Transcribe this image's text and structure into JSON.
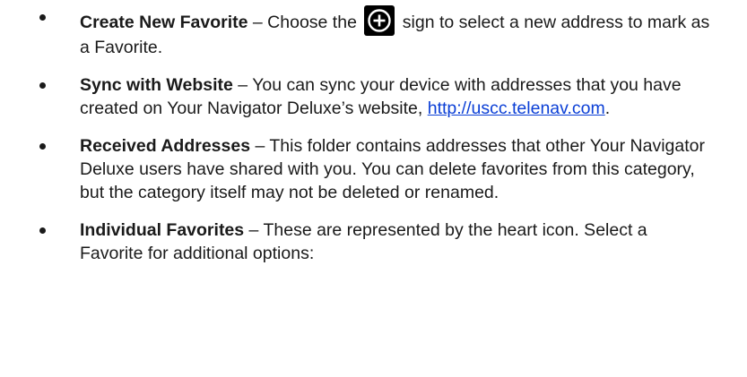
{
  "items": [
    {
      "term": "Create New Favorite",
      "text_before_icon": " – Choose the ",
      "icon": "plus-circle-icon",
      "text_after_icon": " sign to select a new address to mark as a Favorite."
    },
    {
      "term": "Sync with Website",
      "text": " – You can sync your device with addresses that you have created on Your Navigator Deluxe’s website, ",
      "link": "http://uscc.telenav.com",
      "text_after_link": "."
    },
    {
      "term": "Received Addresses",
      "text": " – This folder contains addresses that other Your Navigator Deluxe users have shared with you. You can delete favorites from this category, but the category itself may not be deleted or renamed."
    },
    {
      "term": "Individual Favorites",
      "text": " – These are represented by the heart icon. Select a Favorite for additional options:"
    }
  ]
}
